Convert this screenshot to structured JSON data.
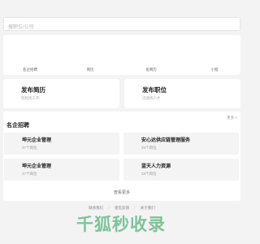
{
  "search": {
    "placeholder": "搜职位/公司"
  },
  "quicknav": {
    "items": [
      {
        "label": "名企招聘"
      },
      {
        "label": "简历"
      },
      {
        "label": "投简历"
      },
      {
        "label": "小程"
      }
    ]
  },
  "post_cards": [
    {
      "title": "发布简历",
      "subtitle": "轻松找工作"
    },
    {
      "title": "发布职位",
      "subtitle": "迅速找人才"
    }
  ],
  "famous": {
    "heading": "名企招聘",
    "more_label": "更多 >",
    "companies": [
      {
        "name": "坤元企业管理",
        "jobs": "47个岗位"
      },
      {
        "name": "安心达供应链管理服务",
        "jobs": "34个岗位"
      },
      {
        "name": "坤元企业管理",
        "jobs": "47个岗位"
      },
      {
        "name": "蓝天人力资源",
        "jobs": "33个岗位"
      }
    ],
    "view_more": "查看更多"
  },
  "footer": {
    "links": [
      "联系我们",
      "意见反馈",
      "关于我们"
    ]
  },
  "watermark": {
    "text": "千狐秒收录"
  },
  "colors": {
    "page_bg": "#f3f3f3",
    "card_bg": "#ffffff",
    "company_bg": "#f4f4f4",
    "watermark": "#7fc29b"
  }
}
